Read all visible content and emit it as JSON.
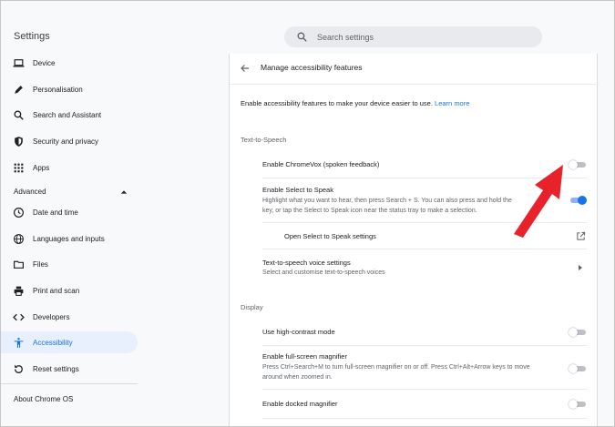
{
  "app": {
    "title": "Settings"
  },
  "search": {
    "placeholder": "Search settings"
  },
  "sidebar": {
    "items": [
      {
        "label": "Device",
        "icon": "laptop-icon"
      },
      {
        "label": "Personalisation",
        "icon": "pen-icon"
      },
      {
        "label": "Search and Assistant",
        "icon": "search-icon"
      },
      {
        "label": "Security and privacy",
        "icon": "shield-icon"
      },
      {
        "label": "Apps",
        "icon": "apps-grid-icon"
      }
    ],
    "advanced_label": "Advanced",
    "advanced_items": [
      {
        "label": "Date and time",
        "icon": "clock-icon"
      },
      {
        "label": "Languages and inputs",
        "icon": "globe-icon"
      },
      {
        "label": "Files",
        "icon": "folder-icon"
      },
      {
        "label": "Print and scan",
        "icon": "printer-icon"
      },
      {
        "label": "Developers",
        "icon": "code-icon"
      },
      {
        "label": "Accessibility",
        "icon": "accessibility-icon",
        "active": true
      },
      {
        "label": "Reset settings",
        "icon": "reset-icon"
      }
    ],
    "about_label": "About Chrome OS"
  },
  "main": {
    "title": "Manage accessibility features",
    "intro_text": "Enable accessibility features to make your device easier to use.",
    "intro_link": "Learn more",
    "tts": {
      "section_title": "Text-to-Speech",
      "chromevox_label": "Enable ChromeVox (spoken feedback)",
      "chromevox_on": false,
      "select_to_speak_label": "Enable Select to Speak",
      "select_to_speak_sub_line1": "Highlight what you want to hear, then press Search + S. You can also press and hold the",
      "select_to_speak_sub_line2": "key, or tap the Select to Speak icon near the status tray to make a selection.",
      "select_to_speak_on": true,
      "open_settings_label": "Open Select to Speak settings",
      "voice_settings_label": "Text-to-speech voice settings",
      "voice_settings_sub": "Select and customise text-to-speech voices"
    },
    "display": {
      "section_title": "Display",
      "high_contrast_label": "Use high-contrast mode",
      "high_contrast_on": false,
      "fullscreen_mag_label": "Enable full-screen magnifier",
      "fullscreen_mag_sub_line1": "Press Ctrl+Search+M to turn full-screen magnifier on or off. Press Ctrl+Alt+Arrow keys to move",
      "fullscreen_mag_sub_line2": "around when zoomed in.",
      "fullscreen_mag_on": false,
      "docked_mag_label": "Enable docked magnifier",
      "docked_mag_on": false
    }
  },
  "colors": {
    "accent": "#1a73e8",
    "annotation": "#e8222a"
  }
}
